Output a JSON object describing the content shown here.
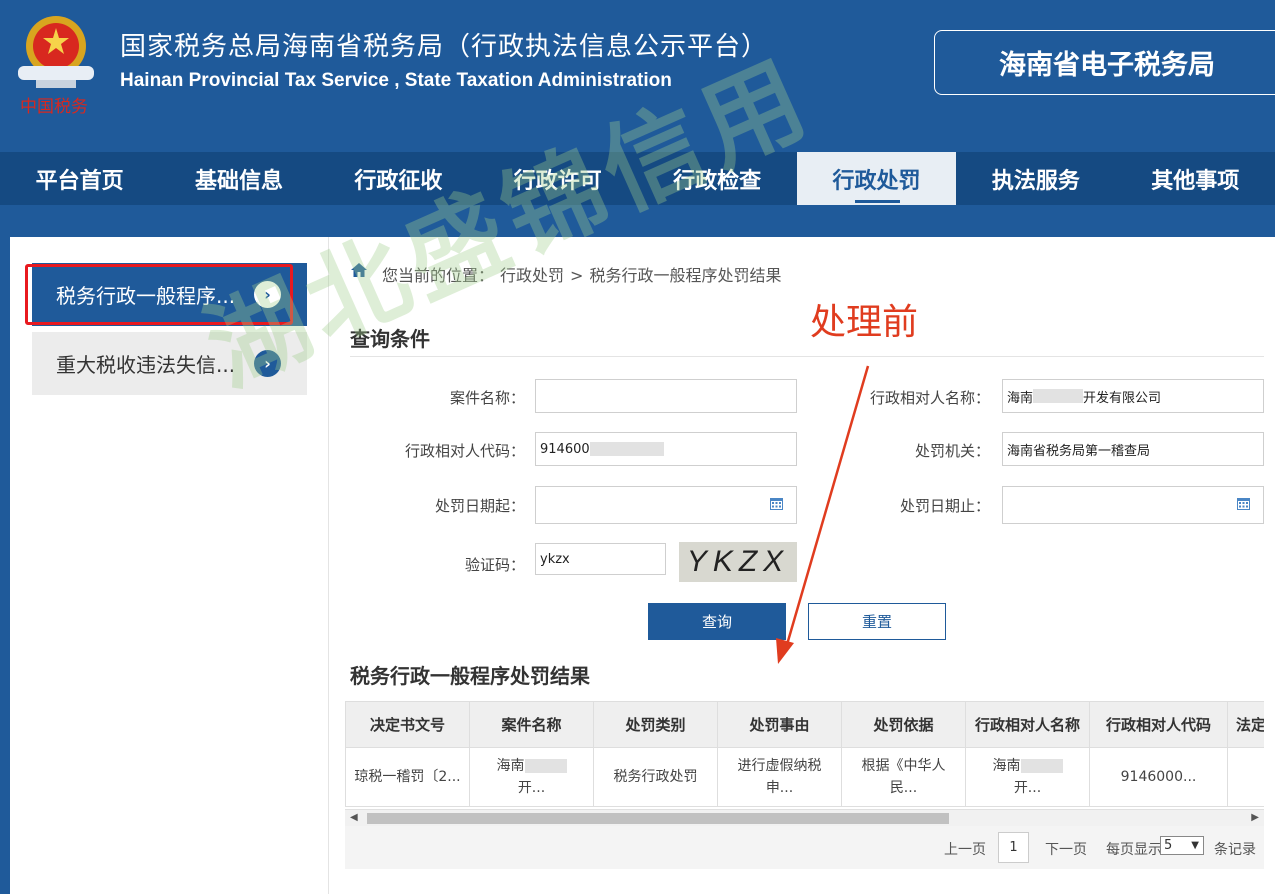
{
  "header": {
    "title_cn": "国家税务总局海南省税务局（行政执法信息公示平台）",
    "title_en": "Hainan Provincial Tax Service , State Taxation Administration",
    "logo_text": "中国税务",
    "etax_button": "海南省电子税务局"
  },
  "nav": {
    "items": [
      {
        "label": "平台首页"
      },
      {
        "label": "基础信息"
      },
      {
        "label": "行政征收"
      },
      {
        "label": "行政许可"
      },
      {
        "label": "行政检查"
      },
      {
        "label": "行政处罚"
      },
      {
        "label": "执法服务"
      },
      {
        "label": "其他事项"
      }
    ],
    "active": "行政处罚"
  },
  "sidebar": {
    "items": [
      {
        "label": "税务行政一般程序..."
      },
      {
        "label": "重大税收违法失信..."
      }
    ]
  },
  "breadcrumb": {
    "prefix": "您当前的位置：",
    "level1": "行政处罚",
    "sep": ">",
    "level2": "税务行政一般程序处罚结果"
  },
  "query": {
    "section_title": "查询条件",
    "case_name_label": "案件名称：",
    "case_name_value": "",
    "party_name_label": "行政相对人名称：",
    "party_name_value_a": "海南",
    "party_name_value_b": "开发有限公司",
    "party_code_label": "行政相对人代码：",
    "party_code_value": "914600",
    "authority_label": "处罚机关：",
    "authority_value": "海南省税务局第一稽查局",
    "date_from_label": "处罚日期起：",
    "date_to_label": "处罚日期止：",
    "captcha_label": "验证码：",
    "captcha_value": "ykzx",
    "captcha_image_text": "YKZX",
    "query_button": "查询",
    "reset_button": "重置"
  },
  "results": {
    "section_title": "税务行政一般程序处罚结果",
    "columns": [
      "决定书文号",
      "案件名称",
      "处罚类别",
      "处罚事由",
      "处罚依据",
      "行政相对人名称",
      "行政相对人代码",
      "法定"
    ],
    "rows": [
      {
        "c0": "琼税一稽罚〔2...",
        "c1a": "海南",
        "c1b": "开...",
        "c2": "税务行政处罚",
        "c3a": "进行虚假纳税",
        "c3b": "申...",
        "c4a": "根据《中华人",
        "c4b": "民...",
        "c5a": "海南",
        "c5b": "开...",
        "c6": "9146000...",
        "c7": ""
      }
    ]
  },
  "pager": {
    "prev": "上一页",
    "page": "1",
    "next": "下一页",
    "per_page_label": "每页显示",
    "per_page_value": "5",
    "records_label": "条记录"
  },
  "annotation": {
    "text": "处理前",
    "color": "#e03c1f"
  },
  "watermark": {
    "text": "湖北盛锦信用"
  },
  "colors": {
    "brand_blue": "#1f5a9a",
    "nav_blue": "#154a82",
    "highlight_red": "#e8191f"
  }
}
